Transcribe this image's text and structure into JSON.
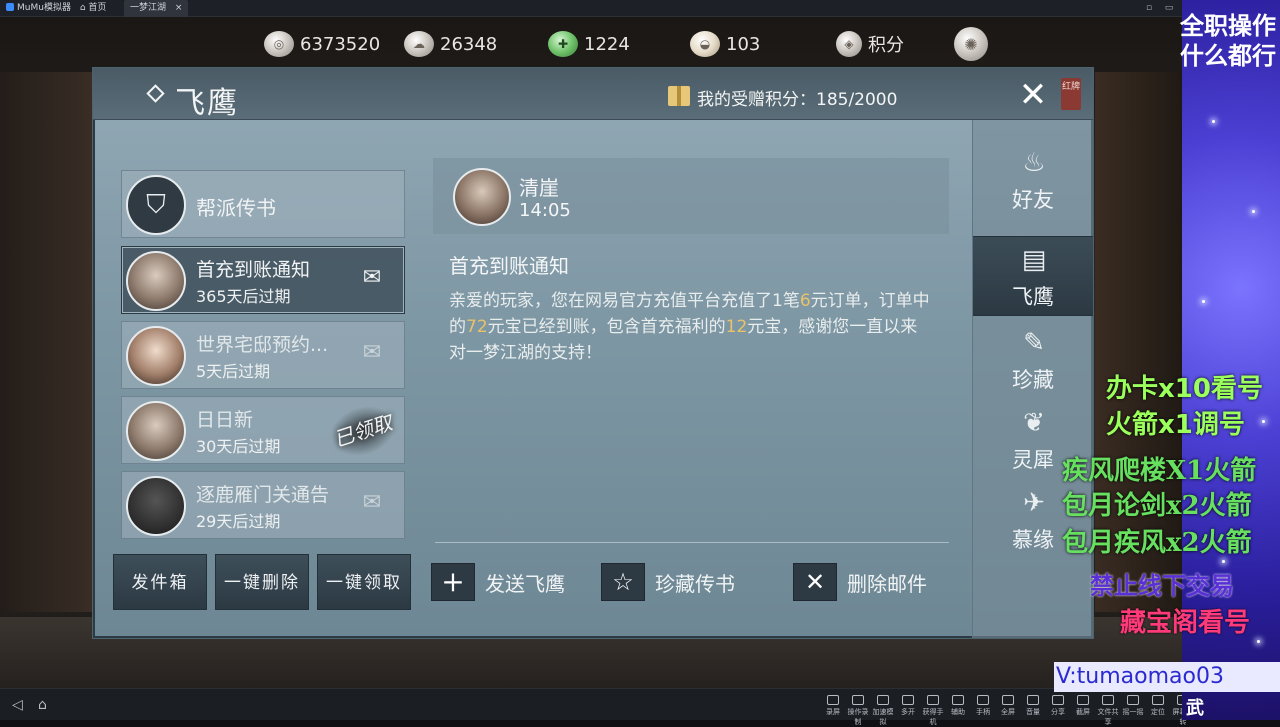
{
  "emulator": {
    "home_tab": "MuMu模拟器",
    "home_label": "首页",
    "game_tab": "一梦江湖"
  },
  "currency": {
    "coins": "6373520",
    "silver": "26348",
    "jade": "1224",
    "ingot": "103",
    "points_label": "积分"
  },
  "panel": {
    "title": "飞鹰",
    "points_text": "我的受赠积分：185/2000",
    "close_icon": "✕",
    "seal_text": "红牌"
  },
  "mail_list": [
    {
      "title": "帮派传书"
    },
    {
      "title": "首充到账通知",
      "expiry": "365天后过期"
    },
    {
      "title": "世界宅邸预约...",
      "expiry": "5天后过期"
    },
    {
      "title": "日日新",
      "expiry": "30天后过期",
      "stamp": "已领取"
    },
    {
      "title": "逐鹿雁门关通告",
      "expiry": "29天后过期"
    }
  ],
  "left_buttons": {
    "outbox": "发件箱",
    "delete_all": "一键删除",
    "claim_all": "一键领取"
  },
  "message": {
    "sender": "清崖",
    "time": "14:05",
    "title": "首充到账通知",
    "body": {
      "p1": "亲爱的玩家，您在网易官方充值平台充值了1笔",
      "n1": "6",
      "p2": "元订单，订单中的",
      "n2": "72",
      "p3": "元宝已经到账，包含首充福利的",
      "n3": "12",
      "p4": "元宝，感谢您一直以来对一梦江湖的支持！"
    },
    "highlight_color": "#e8c36a"
  },
  "actions": {
    "send": "发送飞鹰",
    "favorite": "珍藏传书",
    "delete": "删除邮件"
  },
  "sidenav": [
    {
      "label": "好友",
      "icon": "teapot-icon"
    },
    {
      "label": "飞鹰",
      "icon": "scroll-icon"
    },
    {
      "label": "珍藏",
      "icon": "book-icon"
    },
    {
      "label": "灵犀",
      "icon": "charm-icon"
    },
    {
      "label": "慕缘",
      "icon": "crane-icon"
    }
  ],
  "taskbar": {
    "tools": [
      "录屏",
      "操作录制",
      "加速模拟",
      "多开",
      "获得手机",
      "辅助",
      "手柄",
      "全屏",
      "音量",
      "分享",
      "截屏",
      "文件共享",
      "摇一摇",
      "定位",
      "屏幕旋转"
    ]
  },
  "overlay": {
    "top1": "全职操作",
    "top2": "什么都行",
    "line_a": "办卡x10看号",
    "line_b": "火箭x1调号",
    "line_c": "疾风爬楼X1火箭",
    "line_d": "包月论剑x2火箭",
    "line_e": "包月疾风x2火箭",
    "line_f": "禁止线下交易",
    "line_g": "藏宝阁看号",
    "vx": "V:tumaomao03",
    "bottom": "武"
  }
}
